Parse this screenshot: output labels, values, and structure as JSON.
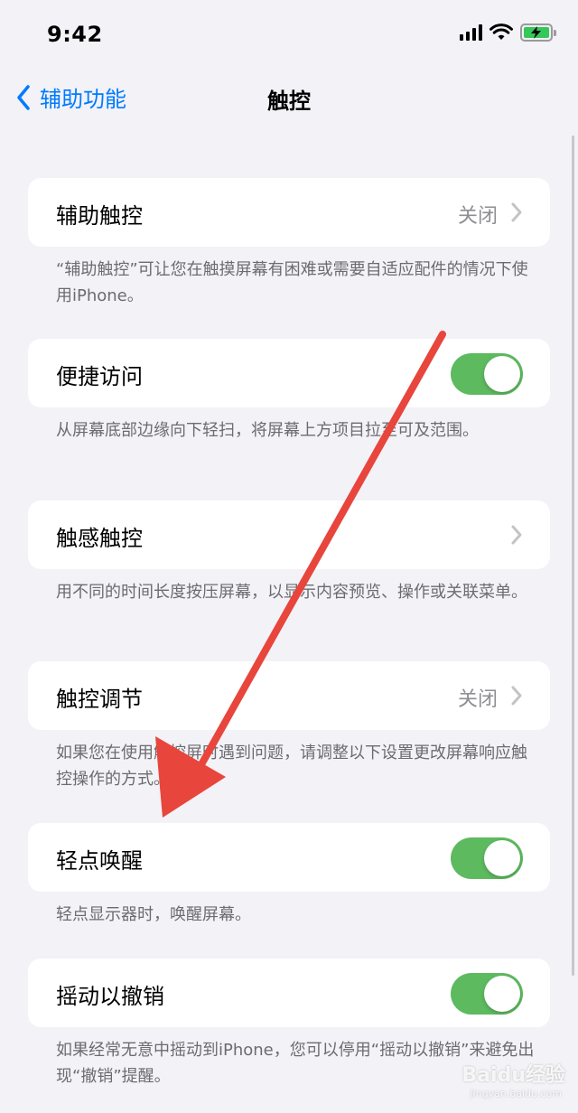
{
  "status_bar": {
    "time": "9:42"
  },
  "nav": {
    "back_label": "辅助功能",
    "title": "触控"
  },
  "rows": [
    {
      "label": "辅助触控",
      "value": "关闭",
      "control": "chevron",
      "footnote": "“辅助触控”可让您在触摸屏幕有困难或需要自适应配件的情况下使用iPhone。"
    },
    {
      "label": "便捷访问",
      "control": "toggle",
      "on": true,
      "footnote": "从屏幕底部边缘向下轻扫，将屏幕上方项目拉至可及范围。"
    },
    {
      "label": "触感触控",
      "value": "",
      "control": "chevron",
      "footnote": "用不同的时间长度按压屏幕，以显示内容预览、操作或关联菜单。"
    },
    {
      "label": "触控调节",
      "value": "关闭",
      "control": "chevron",
      "footnote": "如果您在使用触控屏时遇到问题，请调整以下设置更改屏幕响应触控操作的方式。"
    },
    {
      "label": "轻点唤醒",
      "control": "toggle",
      "on": true,
      "footnote": "轻点显示器时，唤醒屏幕。"
    },
    {
      "label": "摇动以撤销",
      "control": "toggle",
      "on": true,
      "footnote": "如果经常无意中摇动到iPhone，您可以停用“摇动以撤销”来避免出现“撤销”提醒。"
    }
  ],
  "watermark": {
    "text": "Baidu经验",
    "sub": "jingyan.baidu.com"
  },
  "colors": {
    "accent": "#007aff",
    "toggle_on": "#5dba5f",
    "annotation_arrow": "#e8453c"
  }
}
